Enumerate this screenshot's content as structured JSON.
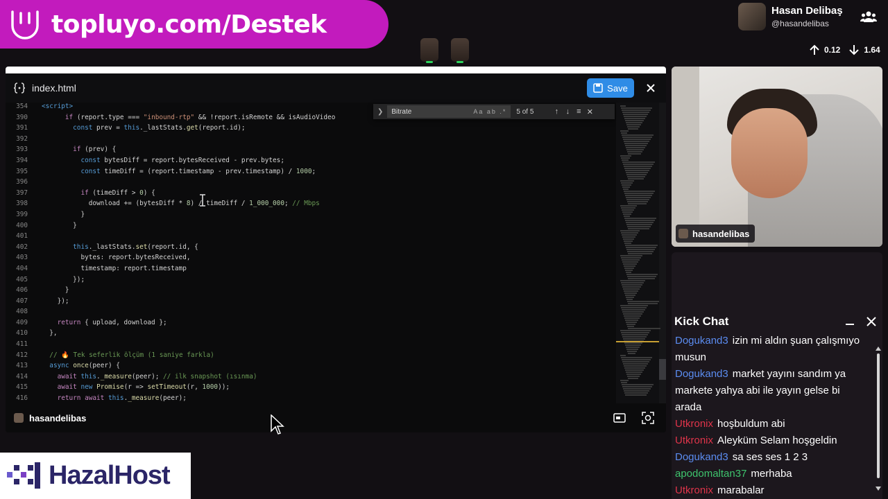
{
  "banner": {
    "url": "topluyo.com/Destek"
  },
  "profile": {
    "display_name": "Hasan Delibaş",
    "handle": "@hasandelibas"
  },
  "net_stats": {
    "upload": "0.12",
    "download": "1.64"
  },
  "editor": {
    "filename": "index.html",
    "save_label": "Save",
    "find": {
      "query": "Bitrate",
      "options": "Aa ab .*",
      "count": "5 of 5"
    },
    "lines": [
      {
        "n": "354",
        "html": "<span class=\"tag\">&lt;script&gt;</span>"
      },
      {
        "n": "390",
        "html": "      <span class=\"kw\">if</span> (report.type === <span class=\"str\">\"inbound-rtp\"</span> &amp;&amp; !report.isRemote &amp;&amp; isAudioVideo"
      },
      {
        "n": "391",
        "html": "        <span class=\"kw2\">const</span> prev = <span class=\"kw2\">this</span>._lastStats.<span class=\"fn\">get</span>(report.id);"
      },
      {
        "n": "392",
        "html": ""
      },
      {
        "n": "393",
        "html": "        <span class=\"kw\">if</span> (prev) {"
      },
      {
        "n": "394",
        "html": "          <span class=\"kw2\">const</span> bytesDiff = report.bytesReceived - prev.bytes;"
      },
      {
        "n": "395",
        "html": "          <span class=\"kw2\">const</span> timeDiff = (report.timestamp - prev.timestamp) / <span class=\"num\">1000</span>;"
      },
      {
        "n": "396",
        "html": ""
      },
      {
        "n": "397",
        "html": "          <span class=\"kw\">if</span> (timeDiff &gt; <span class=\"num\">0</span>) {"
      },
      {
        "n": "398",
        "html": "            download += (bytesDiff * <span class=\"num\">8</span>) / timeDiff / <span class=\"num\">1_000_000</span>; <span class=\"cmt\">// Mbps</span>"
      },
      {
        "n": "399",
        "html": "          }"
      },
      {
        "n": "400",
        "html": "        }"
      },
      {
        "n": "401",
        "html": ""
      },
      {
        "n": "402",
        "html": "        <span class=\"kw2\">this</span>._lastStats.<span class=\"fn\">set</span>(report.id, {"
      },
      {
        "n": "403",
        "html": "          bytes: report.bytesReceived,"
      },
      {
        "n": "404",
        "html": "          timestamp: report.timestamp"
      },
      {
        "n": "405",
        "html": "        });"
      },
      {
        "n": "406",
        "html": "      }"
      },
      {
        "n": "407",
        "html": "    });"
      },
      {
        "n": "408",
        "html": ""
      },
      {
        "n": "409",
        "html": "    <span class=\"kw\">return</span> { upload, download };"
      },
      {
        "n": "410",
        "html": "  },"
      },
      {
        "n": "411",
        "html": ""
      },
      {
        "n": "412",
        "html": "  <span class=\"cmt\">// 🔥 Tek seferlik ölçüm (1 saniye farkla)</span>"
      },
      {
        "n": "413",
        "html": "  <span class=\"kw2\">async</span> <span class=\"fn\">once</span>(peer) {"
      },
      {
        "n": "414",
        "html": "    <span class=\"kw\">await</span> <span class=\"kw2\">this</span>.<span class=\"fn\">_measure</span>(peer); <span class=\"cmt\">// ilk snapshot (ısınma)</span>"
      },
      {
        "n": "415",
        "html": "    <span class=\"kw\">await</span> <span class=\"kw2\">new</span> <span class=\"fn\">Promise</span>(r =&gt; <span class=\"fn\">setTimeout</span>(r, <span class=\"num\">1000</span>));"
      },
      {
        "n": "416",
        "html": "    <span class=\"kw\">return</span> <span class=\"kw\">await</span> <span class=\"kw2\">this</span>.<span class=\"fn\">_measure</span>(peer);"
      }
    ]
  },
  "share_footer": {
    "owner": "hasandelibas"
  },
  "webcam": {
    "name": "hasandelibas"
  },
  "chat": {
    "title": "Kick Chat",
    "messages": [
      {
        "user": "Dogukand3",
        "color": "#5b8cf0",
        "text": "izin mi aldın şuan çalışmıyo musun"
      },
      {
        "user": "Dogukand3",
        "color": "#5b8cf0",
        "text": "market yayını sandım ya markete yahya abi ile yayın gelse bi arada"
      },
      {
        "user": "Utkronix",
        "color": "#e0344a",
        "text": "hoşbuldum abi"
      },
      {
        "user": "Utkronix",
        "color": "#e0344a",
        "text": "Aleyküm Selam hoşgeldin"
      },
      {
        "user": "Dogukand3",
        "color": "#5b8cf0",
        "text": "sa ses ses 1 2 3"
      },
      {
        "user": "apodomaltan37",
        "color": "#3ec46d",
        "text": "merhaba"
      },
      {
        "user": "Utkronix",
        "color": "#e0344a",
        "text": "marabalar"
      }
    ]
  },
  "host_logo": {
    "name": "HazalHost"
  }
}
